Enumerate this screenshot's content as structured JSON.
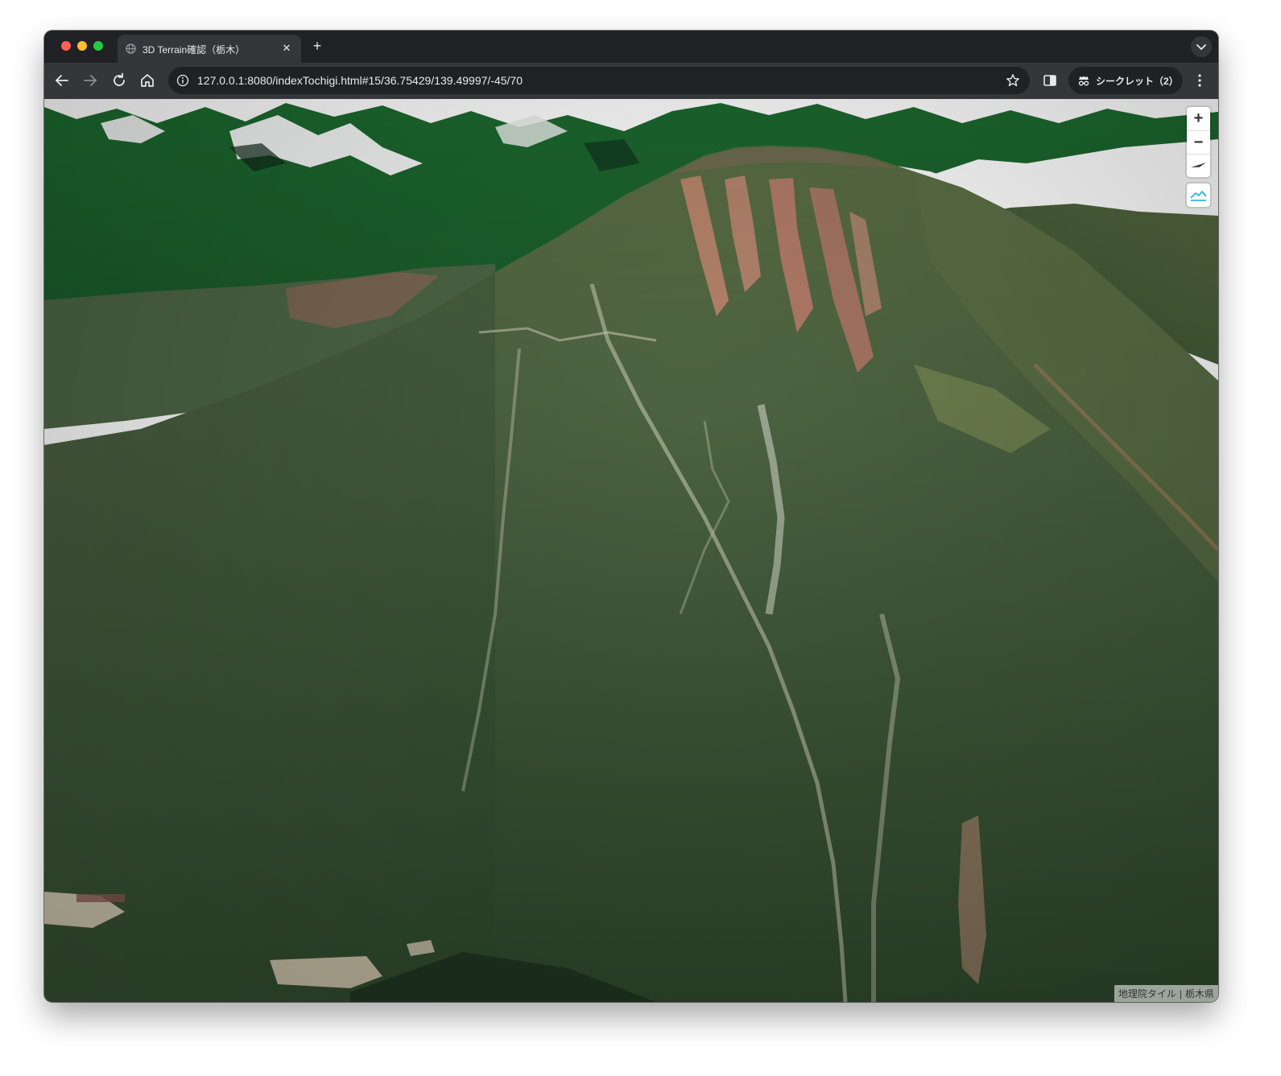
{
  "browser": {
    "tab": {
      "title": "3D Terrain確認（栃木）",
      "favicon": "globe-icon",
      "close_glyph": "✕"
    },
    "new_tab_glyph": "+",
    "url": "127.0.0.1:8080/indexTochigi.html#15/36.75429/139.49997/-45/70",
    "profile": {
      "label": "シークレット（2）",
      "icon": "incognito-icon"
    },
    "icons": [
      "back-arrow-icon",
      "forward-arrow-icon",
      "reload-icon",
      "home-icon",
      "info-icon",
      "bookmark-star-icon",
      "side-panel-icon",
      "kebab-menu-icon",
      "tab-search-chevron-icon"
    ],
    "theme_colors": {
      "frame": "#202124",
      "toolbar": "#35363a",
      "text": "#e8eaed"
    }
  },
  "map": {
    "controls": {
      "zoom_in": "+",
      "zoom_out": "−",
      "compass_icon": "compass-icon",
      "terrain_icon": "terrain-toggle-icon"
    },
    "attribution": {
      "source1": "地理院タイル",
      "separator": "|",
      "source2": "栃木県"
    },
    "colors": {
      "forest": "#3f5a38",
      "forest_dark": "#2f4a2d",
      "distant_ridges": "#1f6b2e",
      "sky": "#ffffff",
      "scar": "#c58870"
    }
  }
}
